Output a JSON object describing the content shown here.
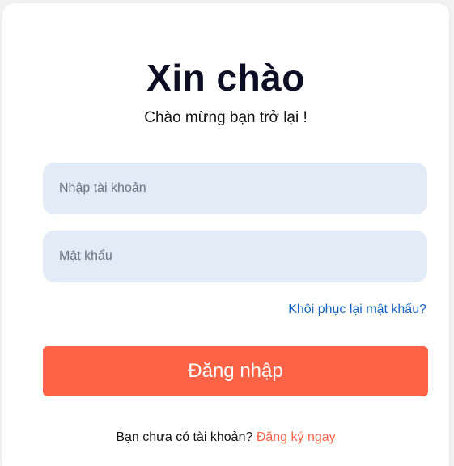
{
  "login": {
    "title": "Xin chào",
    "subtitle": "Chào mừng bạn trở lại !",
    "username_placeholder": "Nhập tài khoản",
    "password_placeholder": "Mật khẩu",
    "forgot_password": "Khôi phục lại mật khẩu?",
    "submit_label": "Đăng nhập",
    "signup_prompt": "Bạn chưa có tài khoản?",
    "signup_link": "Đăng ký ngay"
  },
  "colors": {
    "accent": "#ff6347",
    "link": "#1565c0",
    "input_bg": "#e3ebf7"
  }
}
